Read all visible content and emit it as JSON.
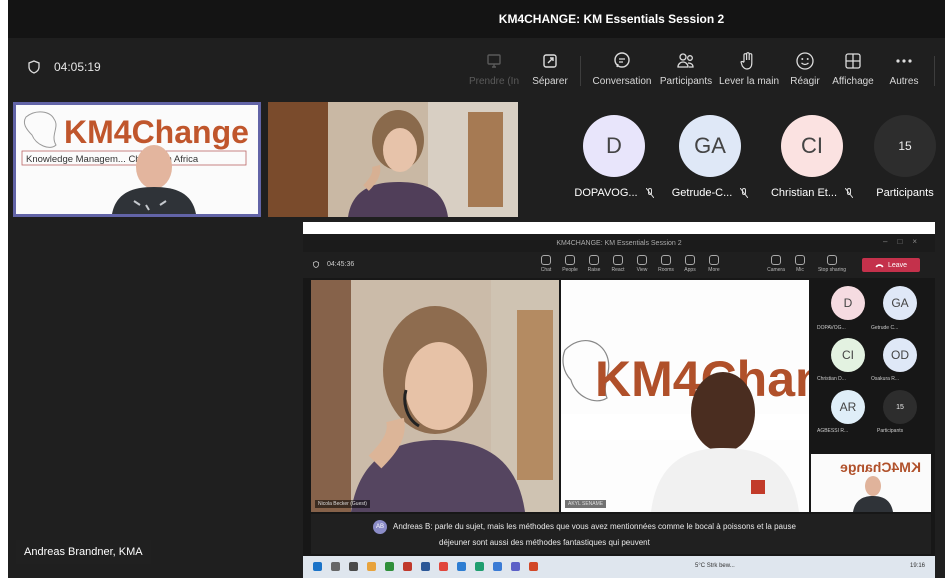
{
  "window": {
    "title": "KM4CHANGE: KM Essentials Session 2"
  },
  "toolbar": {
    "timer": "04:05:19",
    "buttons": [
      {
        "label": "Prendre (In",
        "icon": "share-screen-icon",
        "disabled": true
      },
      {
        "label": "Séparer",
        "icon": "popout-icon"
      },
      {
        "label": "Conversation",
        "icon": "chat-icon"
      },
      {
        "label": "Participants",
        "icon": "people-icon"
      },
      {
        "label": "Lever la main",
        "icon": "raise-hand-icon"
      },
      {
        "label": "Réagir",
        "icon": "smiley-icon"
      },
      {
        "label": "Affichage",
        "icon": "grid-icon"
      },
      {
        "label": "Autres",
        "icon": "more-icon"
      }
    ]
  },
  "tiles": {
    "logo_text": "KM4Change",
    "logo_tagline": "Knowledge Managem... Change in Africa"
  },
  "roster": [
    {
      "initials": "D",
      "name": "DOPAVOG...",
      "color": "#e8e5fb"
    },
    {
      "initials": "GA",
      "name": "Getrude-C...",
      "color": "#dfe8f7"
    },
    {
      "initials": "CI",
      "name": "Christian Et...",
      "color": "#fbe2e1"
    }
  ],
  "participants": {
    "count": "15",
    "label": "Participants"
  },
  "speaker": {
    "name": "Andreas Brandner, KMA"
  },
  "shared_screen": {
    "title": "KM4CHANGE: KM Essentials Session 2",
    "timer": "04:45:36",
    "buttons": [
      "Chat",
      "People",
      "Raise",
      "React",
      "View",
      "Rooms",
      "Apps",
      "More",
      "Camera",
      "Mic",
      "Stop sharing"
    ],
    "leave_label": "Leave",
    "video_a_caption": "Nicola Becker (Guest)",
    "video_b_caption": "AKYL SENAME",
    "roster": [
      {
        "initials": "D",
        "name": "DOPAVOG...",
        "color": "#f5dbe1"
      },
      {
        "initials": "GA",
        "name": "Getrude C...",
        "color": "#dfe8f7"
      },
      {
        "initials": "CI",
        "name": "Christian D...",
        "color": "#e3f2e1"
      },
      {
        "initials": "OD",
        "name": "Osakura R...",
        "color": "#dfe8f7"
      },
      {
        "initials": "AR",
        "name": "AGBESSI R...",
        "color": "#dfeef8"
      }
    ],
    "participants_count": "15",
    "participants_label": "Participants",
    "chat": {
      "initials": "AB",
      "line1": "Andreas B:  parle du sujet, mais les méthodes que vous avez mentionnées comme le bocal à poissons et la pause",
      "line2": "déjeuner sont aussi des méthodes fantastiques qui peuvent"
    },
    "taskbar": {
      "weather": "5°C Strk bew...",
      "time": "19:16"
    }
  }
}
